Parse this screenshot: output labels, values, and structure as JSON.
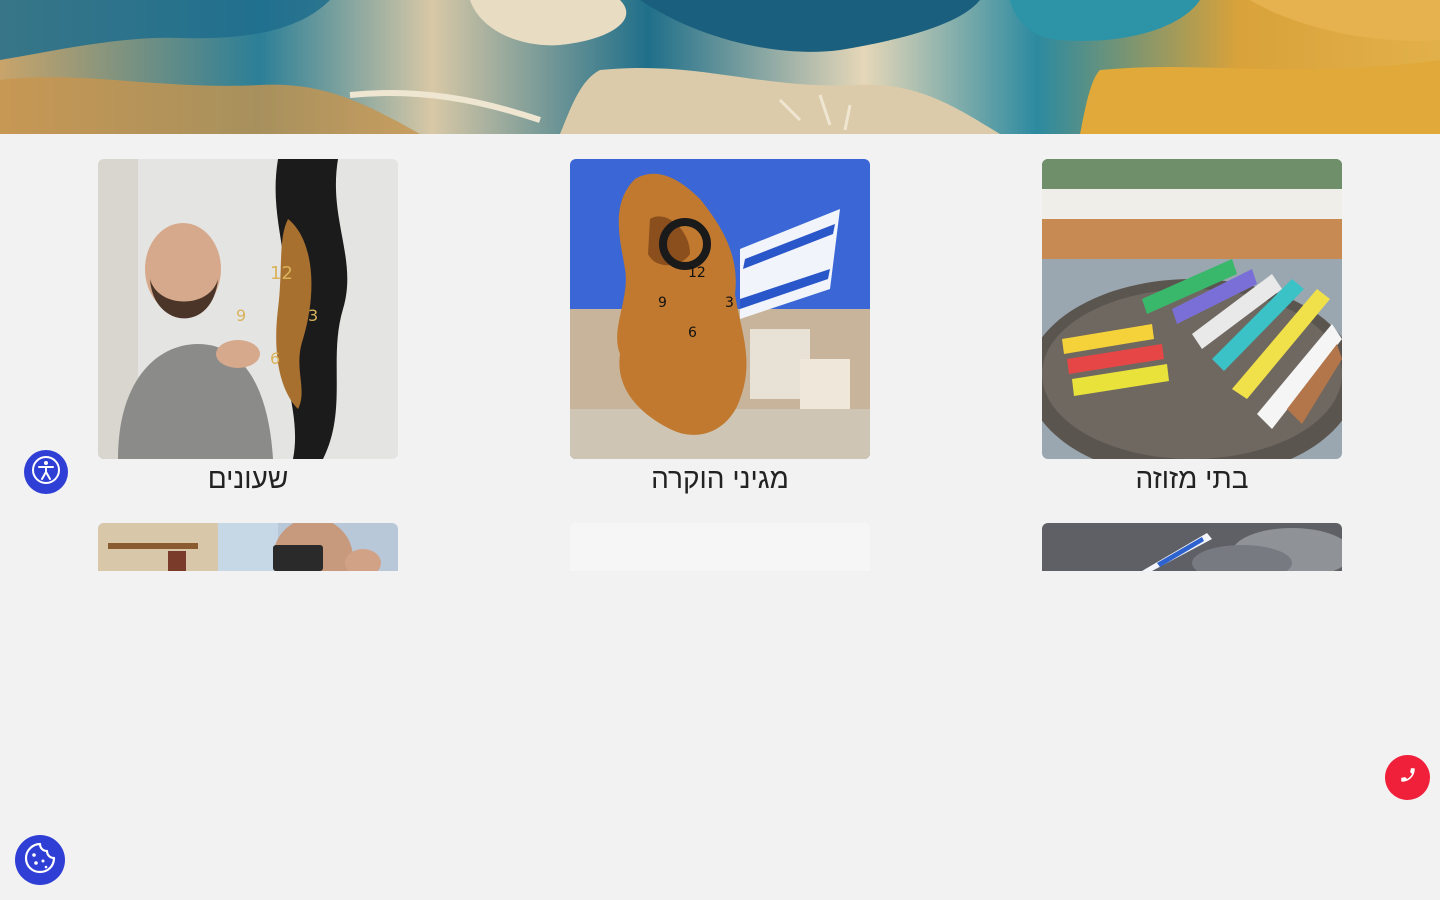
{
  "hero": {
    "image": "resin-landscape-banner"
  },
  "gallery": {
    "row1": [
      {
        "title": "שעונים",
        "image": "man-holding-resin-clock"
      },
      {
        "title": "מגיני הוקרה",
        "image": "olive-wood-map-clock-with-flag"
      },
      {
        "title": "בתי מזוזה",
        "image": "colorful-mezuzah-cases-on-barrel"
      }
    ],
    "row2": [
      {
        "image": "man-selfie-photo"
      },
      {
        "image": "loading-placeholder"
      },
      {
        "image": "flag-and-cloudy-sky"
      }
    ]
  },
  "widgets": {
    "accessibility": {
      "icon": "accessibility-icon"
    },
    "cookies": {
      "icon": "cookie-icon"
    },
    "phone": {
      "icon": "phone-icon"
    }
  },
  "colors": {
    "page_background": "#f2f2f3",
    "widget_blue": "#2f3fd6",
    "phone_red": "#f0203a"
  }
}
